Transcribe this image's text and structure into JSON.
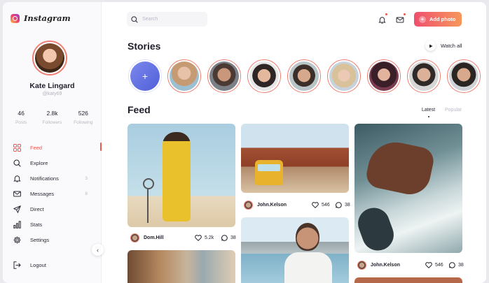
{
  "app": {
    "name": "Instagram"
  },
  "profile": {
    "name": "Kate Lingard",
    "handle": "@katy69"
  },
  "stats": [
    {
      "value": "46",
      "label": "Posts"
    },
    {
      "value": "2.8k",
      "label": "Followers"
    },
    {
      "value": "526",
      "label": "Following"
    }
  ],
  "nav": [
    {
      "label": "Feed",
      "icon": "grid-icon",
      "count": "",
      "active": true
    },
    {
      "label": "Explore",
      "icon": "search-icon",
      "count": ""
    },
    {
      "label": "Notifications",
      "icon": "bell-icon",
      "count": "3"
    },
    {
      "label": "Messages",
      "icon": "mail-icon",
      "count": "8"
    },
    {
      "label": "Direct",
      "icon": "send-icon",
      "count": ""
    },
    {
      "label": "Stats",
      "icon": "bar-chart-icon",
      "count": ""
    },
    {
      "label": "Settings",
      "icon": "gear-icon",
      "count": ""
    }
  ],
  "logout": {
    "label": "Logout"
  },
  "header": {
    "search_placeholder": "Search",
    "add_photo": "Add photo"
  },
  "stories": {
    "title": "Stories",
    "watch_all": "Watch all"
  },
  "feed": {
    "title": "Feed",
    "tabs": [
      "Latest",
      "Popular"
    ],
    "posts": [
      {
        "user": "Dom.Hill",
        "likes": "5.2k",
        "comments": "38"
      },
      {
        "user": "John.Kelson",
        "likes": "546",
        "comments": "38"
      },
      {
        "user": "John.Kelson",
        "likes": "546",
        "comments": "38"
      }
    ]
  },
  "colors": {
    "accent": "#f0554f",
    "button_start": "#f04f6f",
    "button_end": "#f6975b"
  }
}
